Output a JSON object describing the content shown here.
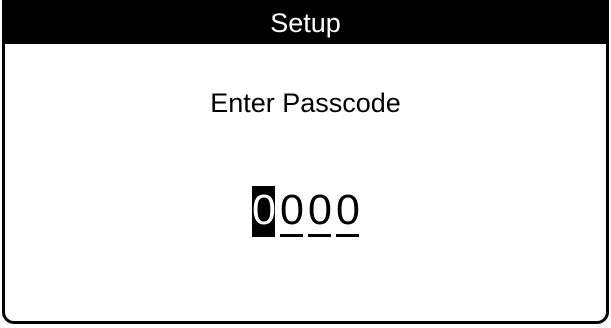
{
  "title": "Setup",
  "prompt": "Enter Passcode",
  "passcode": {
    "digits": [
      "0",
      "0",
      "0",
      "0"
    ],
    "selected_index": 0
  }
}
